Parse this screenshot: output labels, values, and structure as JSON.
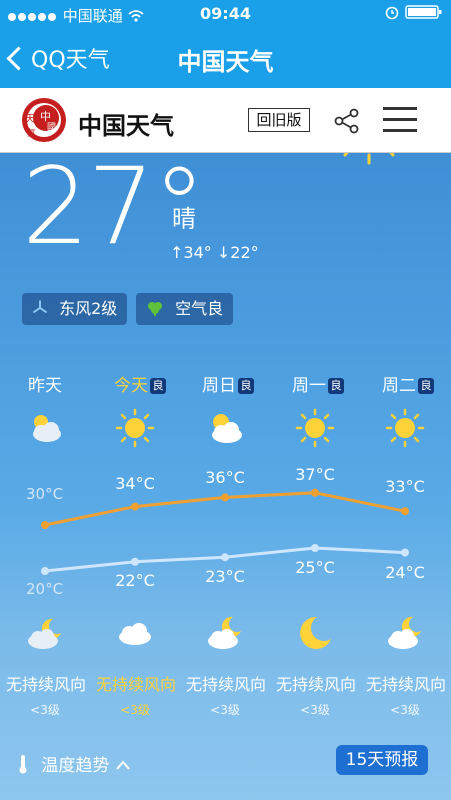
{
  "status": {
    "carrier": "中国联通",
    "time": "09:44"
  },
  "nav": {
    "back_label": "QQ天气",
    "title": "中国天气"
  },
  "site": {
    "brand": "中国天气",
    "old_version": "回旧版",
    "logo_text": "中国天气"
  },
  "current": {
    "temp": "27°",
    "condition": "晴",
    "high": "34°",
    "low": "22°",
    "wind": "东风2级",
    "air": "空气良"
  },
  "days": [
    {
      "name": "昨天",
      "badge": "",
      "icon": "sun-cloud-icon",
      "high": "",
      "low": "",
      "wind": "无持续风向",
      "level": "<3级",
      "night_icon": "moon-cloud-icon"
    },
    {
      "name": "今天",
      "badge": "良",
      "icon": "sun-icon",
      "high": "34°C",
      "low": "22°C",
      "wind": "无持续风向",
      "level": "<3级",
      "night_icon": "cloud-icon"
    },
    {
      "name": "周日",
      "badge": "良",
      "icon": "sun-cloud-icon",
      "high": "36°C",
      "low": "23°C",
      "wind": "无持续风向",
      "level": "<3级",
      "night_icon": "moon-cloud-icon"
    },
    {
      "name": "周一",
      "badge": "良",
      "icon": "sun-icon",
      "high": "37°C",
      "low": "25°C",
      "wind": "无持续风向",
      "level": "<3级",
      "night_icon": "moon-icon"
    },
    {
      "name": "周二",
      "badge": "良",
      "icon": "sun-icon",
      "high": "33°C",
      "low": "24°C",
      "wind": "无持续风向",
      "level": "<3级",
      "night_icon": "moon-cloud-icon"
    }
  ],
  "yesterday": {
    "high": "30°C",
    "low": "20°C"
  },
  "chart_data": {
    "type": "line",
    "categories": [
      "昨天",
      "今天",
      "周日",
      "周一",
      "周二"
    ],
    "series": [
      {
        "values": [
          30,
          34,
          36,
          37,
          33
        ]
      },
      {
        "values": [
          20,
          22,
          23,
          25,
          24
        ]
      }
    ]
  },
  "footer": {
    "trend": "温度趋势",
    "forecast": "15天预报"
  },
  "colors": {
    "accent": "#1aa0e8",
    "today": "#ffd23a",
    "high_line": "#f0a030",
    "low_line": "#cfe6ff"
  }
}
